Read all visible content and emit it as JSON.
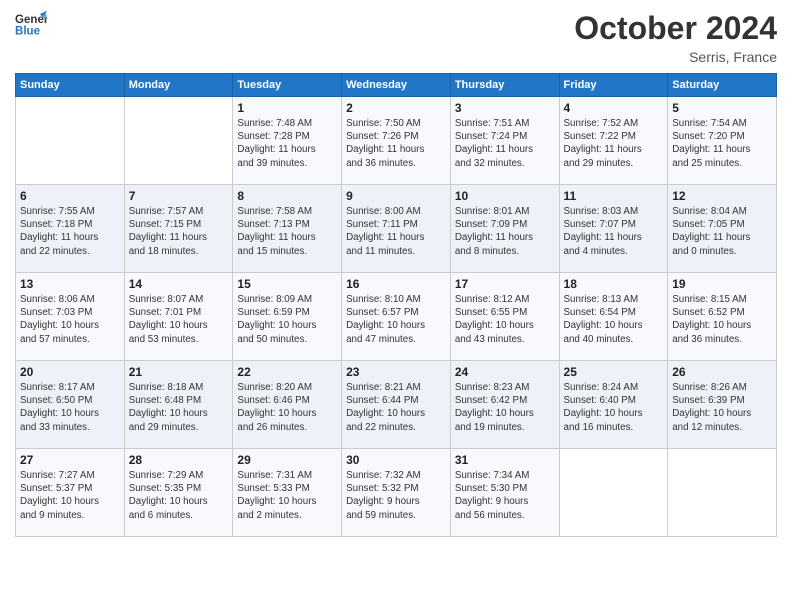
{
  "header": {
    "logo_line1": "General",
    "logo_line2": "Blue",
    "month": "October 2024",
    "location": "Serris, France"
  },
  "weekdays": [
    "Sunday",
    "Monday",
    "Tuesday",
    "Wednesday",
    "Thursday",
    "Friday",
    "Saturday"
  ],
  "weeks": [
    [
      {
        "day": "",
        "info": ""
      },
      {
        "day": "",
        "info": ""
      },
      {
        "day": "1",
        "info": "Sunrise: 7:48 AM\nSunset: 7:28 PM\nDaylight: 11 hours\nand 39 minutes."
      },
      {
        "day": "2",
        "info": "Sunrise: 7:50 AM\nSunset: 7:26 PM\nDaylight: 11 hours\nand 36 minutes."
      },
      {
        "day": "3",
        "info": "Sunrise: 7:51 AM\nSunset: 7:24 PM\nDaylight: 11 hours\nand 32 minutes."
      },
      {
        "day": "4",
        "info": "Sunrise: 7:52 AM\nSunset: 7:22 PM\nDaylight: 11 hours\nand 29 minutes."
      },
      {
        "day": "5",
        "info": "Sunrise: 7:54 AM\nSunset: 7:20 PM\nDaylight: 11 hours\nand 25 minutes."
      }
    ],
    [
      {
        "day": "6",
        "info": "Sunrise: 7:55 AM\nSunset: 7:18 PM\nDaylight: 11 hours\nand 22 minutes."
      },
      {
        "day": "7",
        "info": "Sunrise: 7:57 AM\nSunset: 7:15 PM\nDaylight: 11 hours\nand 18 minutes."
      },
      {
        "day": "8",
        "info": "Sunrise: 7:58 AM\nSunset: 7:13 PM\nDaylight: 11 hours\nand 15 minutes."
      },
      {
        "day": "9",
        "info": "Sunrise: 8:00 AM\nSunset: 7:11 PM\nDaylight: 11 hours\nand 11 minutes."
      },
      {
        "day": "10",
        "info": "Sunrise: 8:01 AM\nSunset: 7:09 PM\nDaylight: 11 hours\nand 8 minutes."
      },
      {
        "day": "11",
        "info": "Sunrise: 8:03 AM\nSunset: 7:07 PM\nDaylight: 11 hours\nand 4 minutes."
      },
      {
        "day": "12",
        "info": "Sunrise: 8:04 AM\nSunset: 7:05 PM\nDaylight: 11 hours\nand 0 minutes."
      }
    ],
    [
      {
        "day": "13",
        "info": "Sunrise: 8:06 AM\nSunset: 7:03 PM\nDaylight: 10 hours\nand 57 minutes."
      },
      {
        "day": "14",
        "info": "Sunrise: 8:07 AM\nSunset: 7:01 PM\nDaylight: 10 hours\nand 53 minutes."
      },
      {
        "day": "15",
        "info": "Sunrise: 8:09 AM\nSunset: 6:59 PM\nDaylight: 10 hours\nand 50 minutes."
      },
      {
        "day": "16",
        "info": "Sunrise: 8:10 AM\nSunset: 6:57 PM\nDaylight: 10 hours\nand 47 minutes."
      },
      {
        "day": "17",
        "info": "Sunrise: 8:12 AM\nSunset: 6:55 PM\nDaylight: 10 hours\nand 43 minutes."
      },
      {
        "day": "18",
        "info": "Sunrise: 8:13 AM\nSunset: 6:54 PM\nDaylight: 10 hours\nand 40 minutes."
      },
      {
        "day": "19",
        "info": "Sunrise: 8:15 AM\nSunset: 6:52 PM\nDaylight: 10 hours\nand 36 minutes."
      }
    ],
    [
      {
        "day": "20",
        "info": "Sunrise: 8:17 AM\nSunset: 6:50 PM\nDaylight: 10 hours\nand 33 minutes."
      },
      {
        "day": "21",
        "info": "Sunrise: 8:18 AM\nSunset: 6:48 PM\nDaylight: 10 hours\nand 29 minutes."
      },
      {
        "day": "22",
        "info": "Sunrise: 8:20 AM\nSunset: 6:46 PM\nDaylight: 10 hours\nand 26 minutes."
      },
      {
        "day": "23",
        "info": "Sunrise: 8:21 AM\nSunset: 6:44 PM\nDaylight: 10 hours\nand 22 minutes."
      },
      {
        "day": "24",
        "info": "Sunrise: 8:23 AM\nSunset: 6:42 PM\nDaylight: 10 hours\nand 19 minutes."
      },
      {
        "day": "25",
        "info": "Sunrise: 8:24 AM\nSunset: 6:40 PM\nDaylight: 10 hours\nand 16 minutes."
      },
      {
        "day": "26",
        "info": "Sunrise: 8:26 AM\nSunset: 6:39 PM\nDaylight: 10 hours\nand 12 minutes."
      }
    ],
    [
      {
        "day": "27",
        "info": "Sunrise: 7:27 AM\nSunset: 5:37 PM\nDaylight: 10 hours\nand 9 minutes."
      },
      {
        "day": "28",
        "info": "Sunrise: 7:29 AM\nSunset: 5:35 PM\nDaylight: 10 hours\nand 6 minutes."
      },
      {
        "day": "29",
        "info": "Sunrise: 7:31 AM\nSunset: 5:33 PM\nDaylight: 10 hours\nand 2 minutes."
      },
      {
        "day": "30",
        "info": "Sunrise: 7:32 AM\nSunset: 5:32 PM\nDaylight: 9 hours\nand 59 minutes."
      },
      {
        "day": "31",
        "info": "Sunrise: 7:34 AM\nSunset: 5:30 PM\nDaylight: 9 hours\nand 56 minutes."
      },
      {
        "day": "",
        "info": ""
      },
      {
        "day": "",
        "info": ""
      }
    ]
  ]
}
